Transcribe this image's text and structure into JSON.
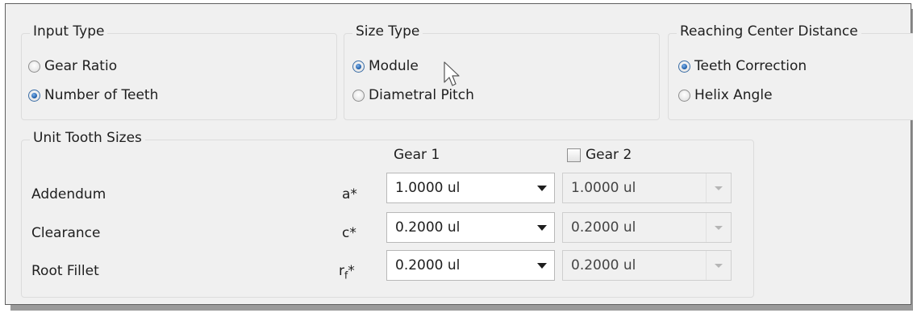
{
  "input_type": {
    "title": "Input Type",
    "options": [
      {
        "label": "Gear Ratio",
        "selected": false
      },
      {
        "label": "Number of Teeth",
        "selected": true
      }
    ]
  },
  "size_type": {
    "title": "Size Type",
    "options": [
      {
        "label": "Module",
        "selected": true
      },
      {
        "label": "Diametral Pitch",
        "selected": false
      }
    ]
  },
  "reaching": {
    "title": "Reaching Center Distance",
    "options": [
      {
        "label": "Teeth Correction",
        "selected": true
      },
      {
        "label": "Helix Angle",
        "selected": false
      }
    ]
  },
  "unit_tooth": {
    "title": "Unit Tooth Sizes",
    "gear1_label": "Gear 1",
    "gear2_label": "Gear 2",
    "gear2_checked": false,
    "rows": [
      {
        "label": "Addendum",
        "symbol": "a*",
        "gear1": "1.0000 ul",
        "gear2": "1.0000 ul"
      },
      {
        "label": "Clearance",
        "symbol": "c*",
        "gear1": "0.2000 ul",
        "gear2": "0.2000 ul"
      },
      {
        "label": "Root Fillet",
        "symbol_base": "r",
        "symbol_sub": "f",
        "symbol_suffix": "*",
        "gear1": "0.2000 ul",
        "gear2": "0.2000 ul"
      }
    ]
  },
  "icons": [
    "radio-button-icon",
    "dropdown-arrow-icon",
    "checkbox-icon",
    "mouse-pointer-icon"
  ]
}
